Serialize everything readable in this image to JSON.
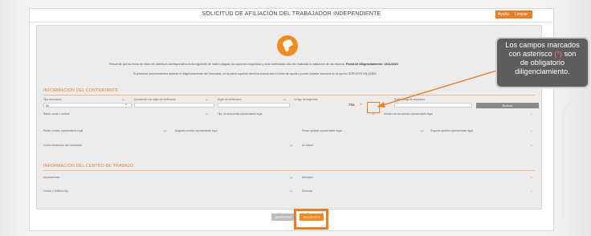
{
  "form": {
    "title": "SOLICITUD DE AFILIACIÓN DEL TRABAJADOR INDEPENDIENTE",
    "help_label": "Ayuda",
    "clear_label": "Limpiar",
    "notice_1_prefix": "Recuerde que su fecha de inicio de cobertura corresponderá al día siguiente de haber cargado los soportes requeridos y será confirmada una vez realizada la validación de los mismos.",
    "notice_1_bold": "Fecha de diligenciamiento: 14/11/2020",
    "notice_2": "Si presenta inconvenientes durante el diligenciamiento del formulario, en la parte superior derecha encontrará el botón de ayuda o puede solicitar asesoría en la opción SOPORTE EN LÍNEA"
  },
  "contratante": {
    "section_title": "INFORMACIÓN DEL CONTRATANTE",
    "fields": {
      "tipo_documento": {
        "label": "Tipo documento",
        "value": "NIt"
      },
      "documento_digito": {
        "label": "Documento con dígito de verificación",
        "value": ""
      },
      "digito_verificacion": {
        "label": "Dígito de verificación",
        "value": ""
      },
      "codigo_seguridad": {
        "label": "Código de seguridad",
        "value": "794"
      },
      "digite_codigo": {
        "label": "Digite código de seguridad",
        "value": ""
      },
      "razon_social": {
        "label": "Razón social o nombre"
      },
      "tipo_doc_rep": {
        "label": "Tipo de documento representante legal"
      },
      "num_doc_rep": {
        "label": "Número de documento representante legal"
      },
      "primer_nombre_rep": {
        "label": "Primer nombre representante legal"
      },
      "segundo_nombre_rep": {
        "label": "Segundo nombre representante legal"
      },
      "primer_apellido_rep": {
        "label": "Primer apellido representante legal"
      },
      "segundo_apellido_rep": {
        "label": "Segundo apellido representante legal"
      },
      "correo": {
        "label": "Correo electrónico del contratante"
      },
      "arl_actual": {
        "label": "Arl Actual"
      }
    },
    "search_label": "Buscar",
    "required_mark": "* *"
  },
  "centro_trabajo": {
    "section_title": "INFORMACIÓN DEL CENTRO DE TRABAJO",
    "fields": {
      "departamento": {
        "label": "Departamento"
      },
      "municipio": {
        "label": "Municipio"
      },
      "celular": {
        "label": "Celular o Teléfono fijo"
      },
      "direccion": {
        "label": "Dirección"
      }
    }
  },
  "pager": {
    "current": "2",
    "total": "4"
  },
  "nav": {
    "previous_label": "ANTERIOR",
    "next_label": "SIGUIENTE"
  },
  "callout": {
    "line1": "Los campos marcados",
    "line2_a": "con asterisco",
    "line2_mark": "(*)",
    "line2_b": "son",
    "line3": "de obligatorio",
    "line4": "diligenciamiento."
  },
  "colors": {
    "accent": "#f07c22",
    "callout_bg": "#5d5d5d"
  },
  "icons": [
    "logo-icon",
    "chevron-down-icon"
  ]
}
